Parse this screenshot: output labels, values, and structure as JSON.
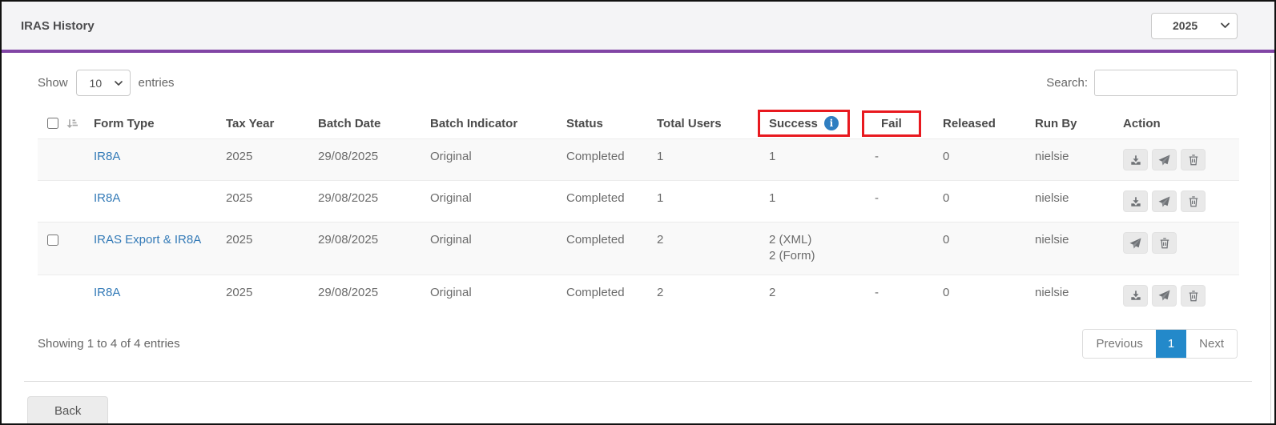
{
  "header": {
    "title": "IRAS History",
    "year": "2025"
  },
  "controls": {
    "show_label": "Show",
    "page_size": "10",
    "entries_label": "entries",
    "search_label": "Search:",
    "search_value": "",
    "search_placeholder": ""
  },
  "table": {
    "columns": {
      "form_type": "Form Type",
      "tax_year": "Tax Year",
      "batch_date": "Batch Date",
      "batch_indicator": "Batch Indicator",
      "status": "Status",
      "total_users": "Total Users",
      "success": "Success",
      "fail": "Fail",
      "released": "Released",
      "run_by": "Run By",
      "action": "Action"
    },
    "rows": [
      {
        "has_checkbox": false,
        "form_type": "IR8A",
        "tax_year": "2025",
        "batch_date": "29/08/2025",
        "batch_indicator": "Original",
        "status": "Completed",
        "total_users": "1",
        "success": "1",
        "fail": "-",
        "released": "0",
        "run_by": "nielsie",
        "actions": [
          "download",
          "send",
          "delete"
        ]
      },
      {
        "has_checkbox": false,
        "form_type": "IR8A",
        "tax_year": "2025",
        "batch_date": "29/08/2025",
        "batch_indicator": "Original",
        "status": "Completed",
        "total_users": "1",
        "success": "1",
        "fail": "-",
        "released": "0",
        "run_by": "nielsie",
        "actions": [
          "download",
          "send",
          "delete"
        ]
      },
      {
        "has_checkbox": true,
        "form_type": "IRAS Export & IR8A",
        "tax_year": "2025",
        "batch_date": "29/08/2025",
        "batch_indicator": "Original",
        "status": "Completed",
        "total_users": "2",
        "success_lines": [
          "2 (XML)",
          "2 (Form)"
        ],
        "fail": "",
        "released": "0",
        "run_by": "nielsie",
        "actions": [
          "send",
          "delete"
        ]
      },
      {
        "has_checkbox": false,
        "form_type": "IR8A",
        "tax_year": "2025",
        "batch_date": "29/08/2025",
        "batch_indicator": "Original",
        "status": "Completed",
        "total_users": "2",
        "success": "2",
        "fail": "-",
        "released": "0",
        "run_by": "nielsie",
        "actions": [
          "download",
          "send",
          "delete"
        ]
      }
    ]
  },
  "footer": {
    "showing_text": "Showing 1 to 4 of 4 entries",
    "pagination": {
      "previous": "Previous",
      "page": "1",
      "next": "Next"
    },
    "back_label": "Back"
  },
  "icons": {
    "sort": "sort-amount-icon",
    "info": "info-icon",
    "download": "download-icon",
    "send": "send-icon",
    "delete": "trash-icon",
    "chevron": "chevron-down-icon"
  },
  "colors": {
    "accent_purple": "#8145a5",
    "link_blue": "#337ab7",
    "active_page_blue": "#2389ca",
    "info_blue": "#2f7ec1",
    "annotation_red": "#e8191f",
    "row_stripe": "#f9f9f9",
    "topbar_bg": "#f4f4f6"
  }
}
